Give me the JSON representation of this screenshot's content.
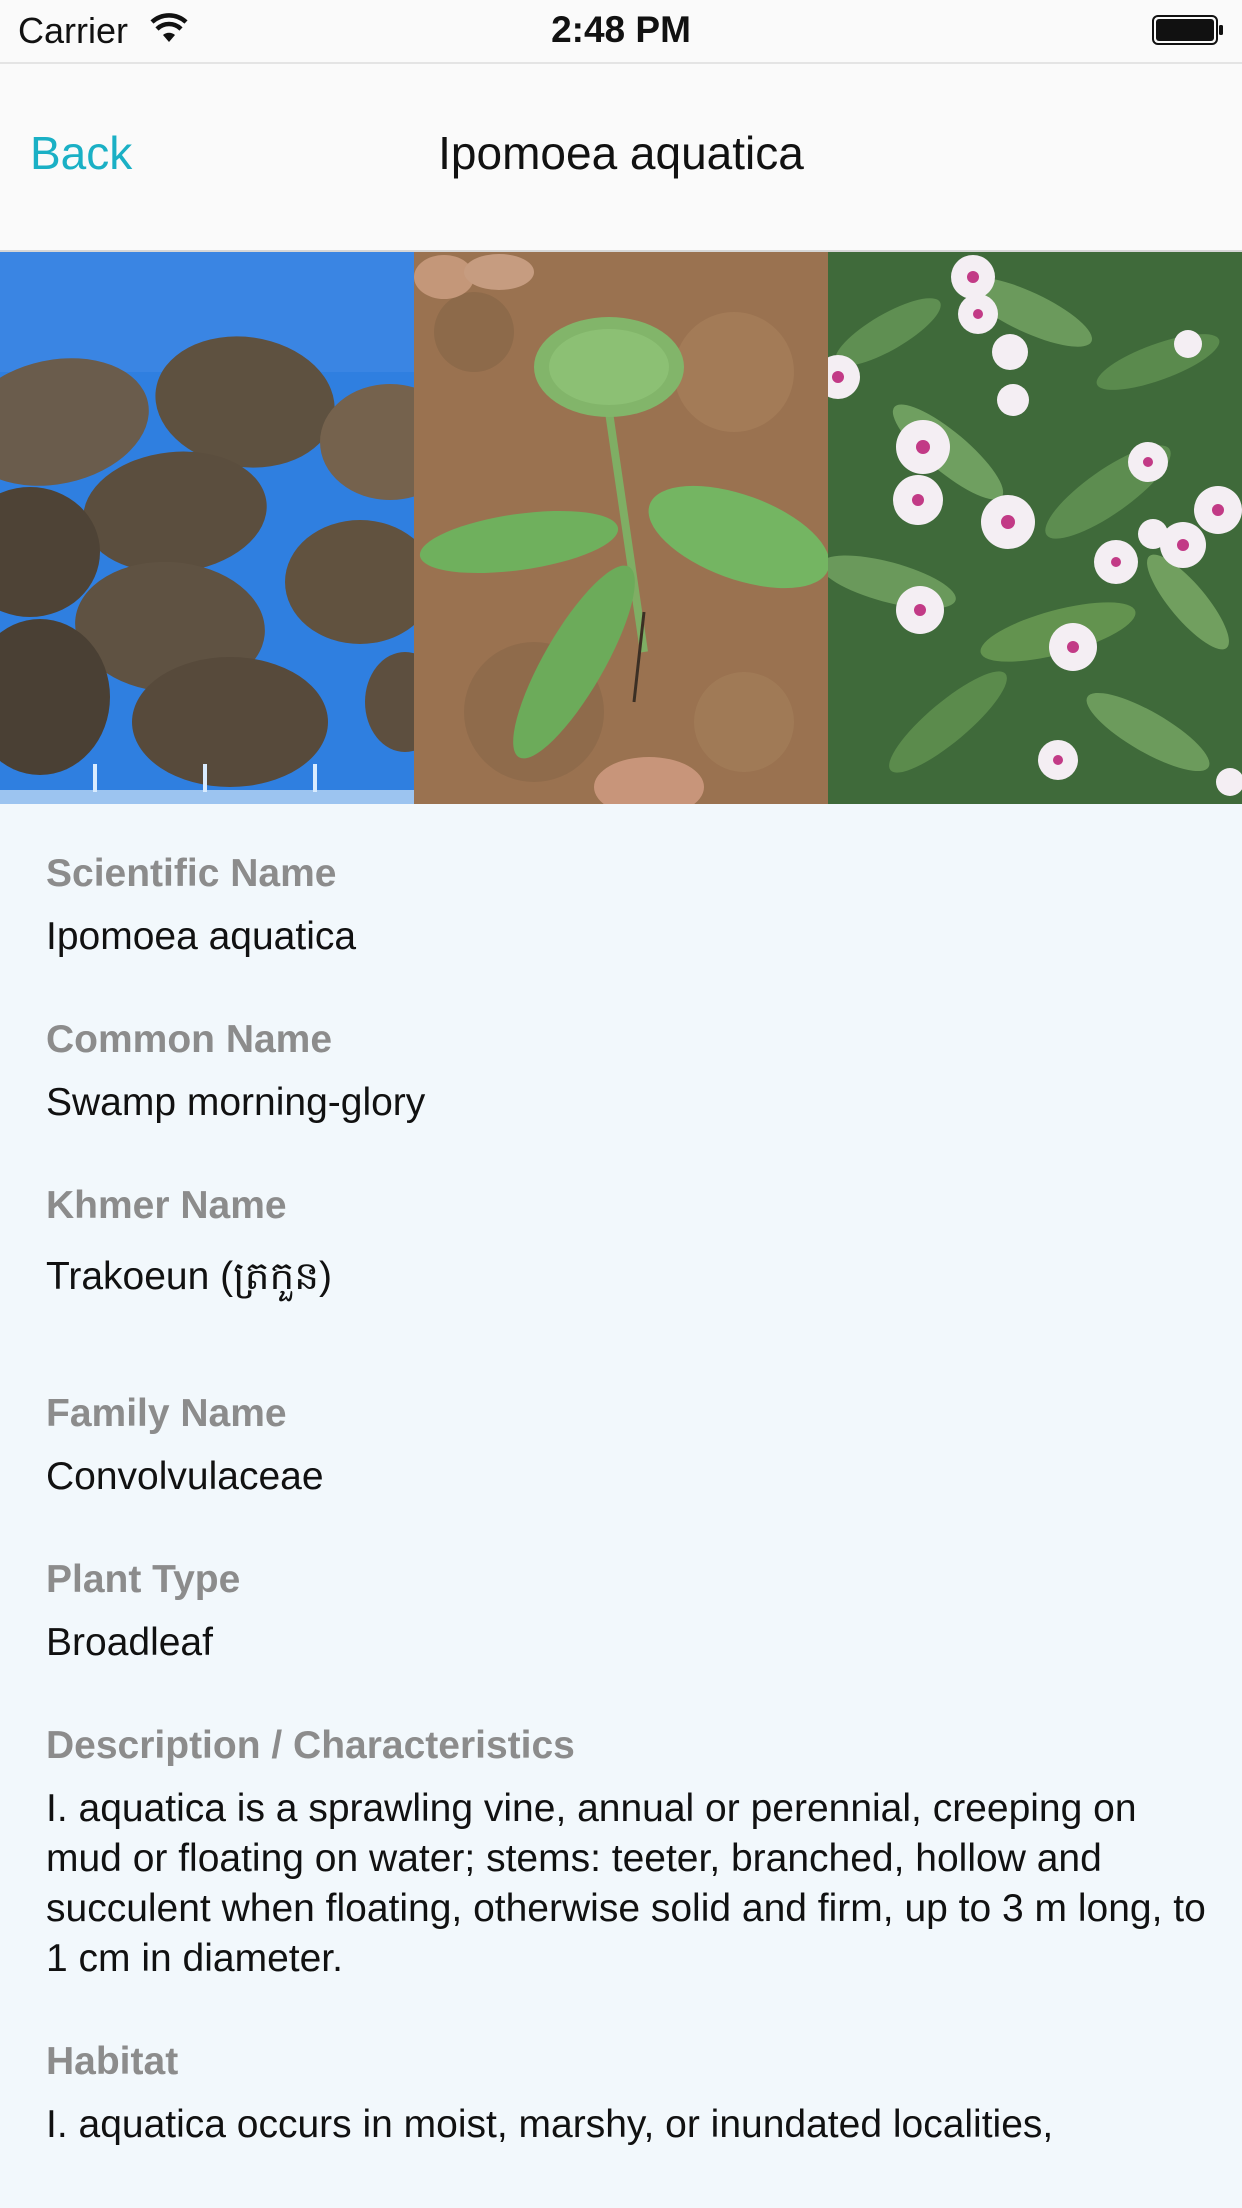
{
  "status_bar": {
    "carrier": "Carrier",
    "time": "2:48 PM"
  },
  "nav": {
    "back_label": "Back",
    "title": "Ipomoea aquatica"
  },
  "gallery": [
    {
      "name": "seeds-photo"
    },
    {
      "name": "seedling-photo"
    },
    {
      "name": "flowers-photo"
    }
  ],
  "details": {
    "scientific_name": {
      "label": "Scientific Name",
      "value": "Ipomoea aquatica"
    },
    "common_name": {
      "label": "Common Name",
      "value": "Swamp morning-glory"
    },
    "khmer_name": {
      "label": "Khmer Name",
      "value": "Trakoeun (ត្រកួន)"
    },
    "family_name": {
      "label": "Family Name",
      "value": "Convolvulaceae"
    },
    "plant_type": {
      "label": "Plant Type",
      "value": "Broadleaf"
    },
    "description": {
      "label": "Description / Characteristics",
      "value": "I. aquatica is a sprawling vine, annual or perennial, creeping on mud or floating on water; stems: teeter, branched, hollow and succulent when floating, otherwise solid and firm, up to 3 m long, to 1 cm in diameter."
    },
    "habitat": {
      "label": "Habitat",
      "value": "I. aquatica occurs in moist, marshy, or inundated localities,"
    }
  },
  "colors": {
    "accent": "#1ab0c5",
    "background": "#f2f8fc",
    "label_gray": "#8c8c8c"
  }
}
